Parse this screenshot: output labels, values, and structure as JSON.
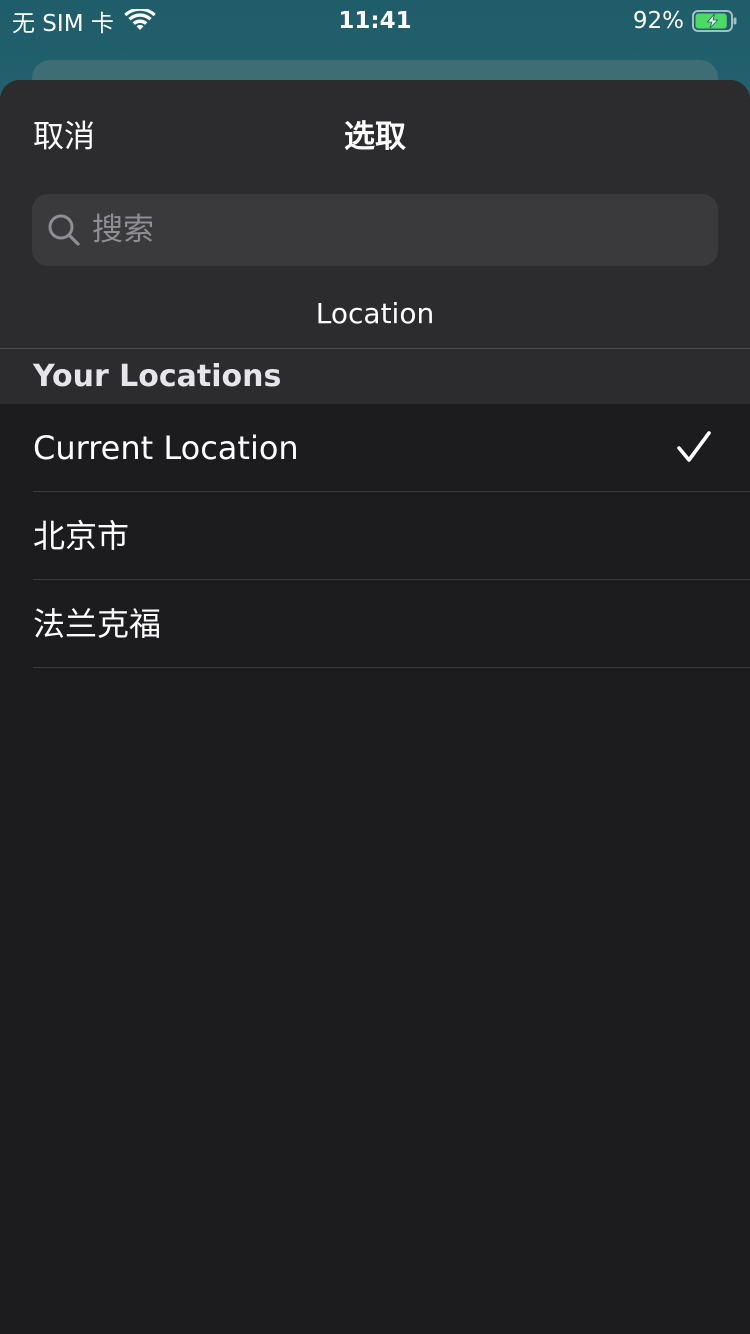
{
  "status_bar": {
    "carrier": "无 SIM 卡",
    "time": "11:41",
    "battery_percent": "92%",
    "battery_level": 0.92,
    "icons": [
      "wifi-icon",
      "battery-charging-icon"
    ]
  },
  "sheet": {
    "cancel_label": "取消",
    "title": "选取",
    "search": {
      "placeholder": "搜索",
      "value": ""
    },
    "scope_label": "Location"
  },
  "section": {
    "header": "Your Locations"
  },
  "locations": [
    {
      "label": "Current Location",
      "selected": true
    },
    {
      "label": "北京市",
      "selected": false
    },
    {
      "label": "法兰克福",
      "selected": false
    }
  ],
  "colors": {
    "sheet_background": "#1c1c1e",
    "header_background": "#2c2c2e",
    "search_background": "#3a3a3c",
    "placeholder": "#8e8e93",
    "battery_fill": "#4cd964"
  }
}
